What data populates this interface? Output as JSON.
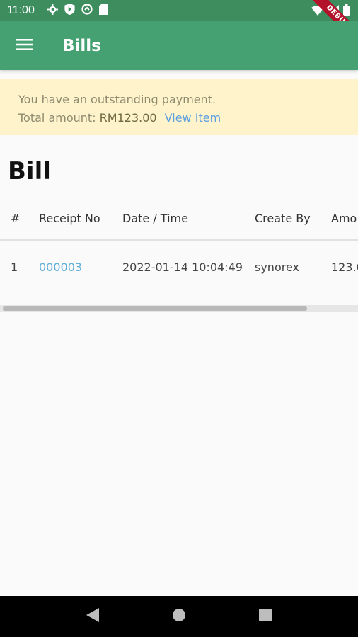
{
  "status_bar": {
    "time": "11:00"
  },
  "app_bar": {
    "title": "Bills"
  },
  "debug_banner": "DEBUG",
  "notice": {
    "line1": "You have an outstanding payment.",
    "total_label": "Total amount:",
    "total_amount": "RM123.00",
    "link": "View Item"
  },
  "page": {
    "heading": "Bill"
  },
  "table": {
    "headers": [
      "#",
      "Receipt No",
      "Date / Time",
      "Create By",
      "Amo"
    ],
    "rows": [
      [
        "1",
        "000003",
        "2022-01-14 10:04:49",
        "synorex",
        "123.0"
      ]
    ]
  },
  "colors": {
    "app_bar": "#45a072",
    "status_bar": "#3d8d5f",
    "notice_bg": "#fff3cc",
    "link": "#5faed9"
  },
  "icons": {
    "status_left": [
      "settings-icon",
      "play-protect-icon",
      "data-saver-icon",
      "sd-card-icon"
    ],
    "status_right": [
      "wifi-icon",
      "cell-signal-icon",
      "battery-icon"
    ],
    "nav": [
      "back-icon",
      "home-icon",
      "recents-icon"
    ]
  }
}
